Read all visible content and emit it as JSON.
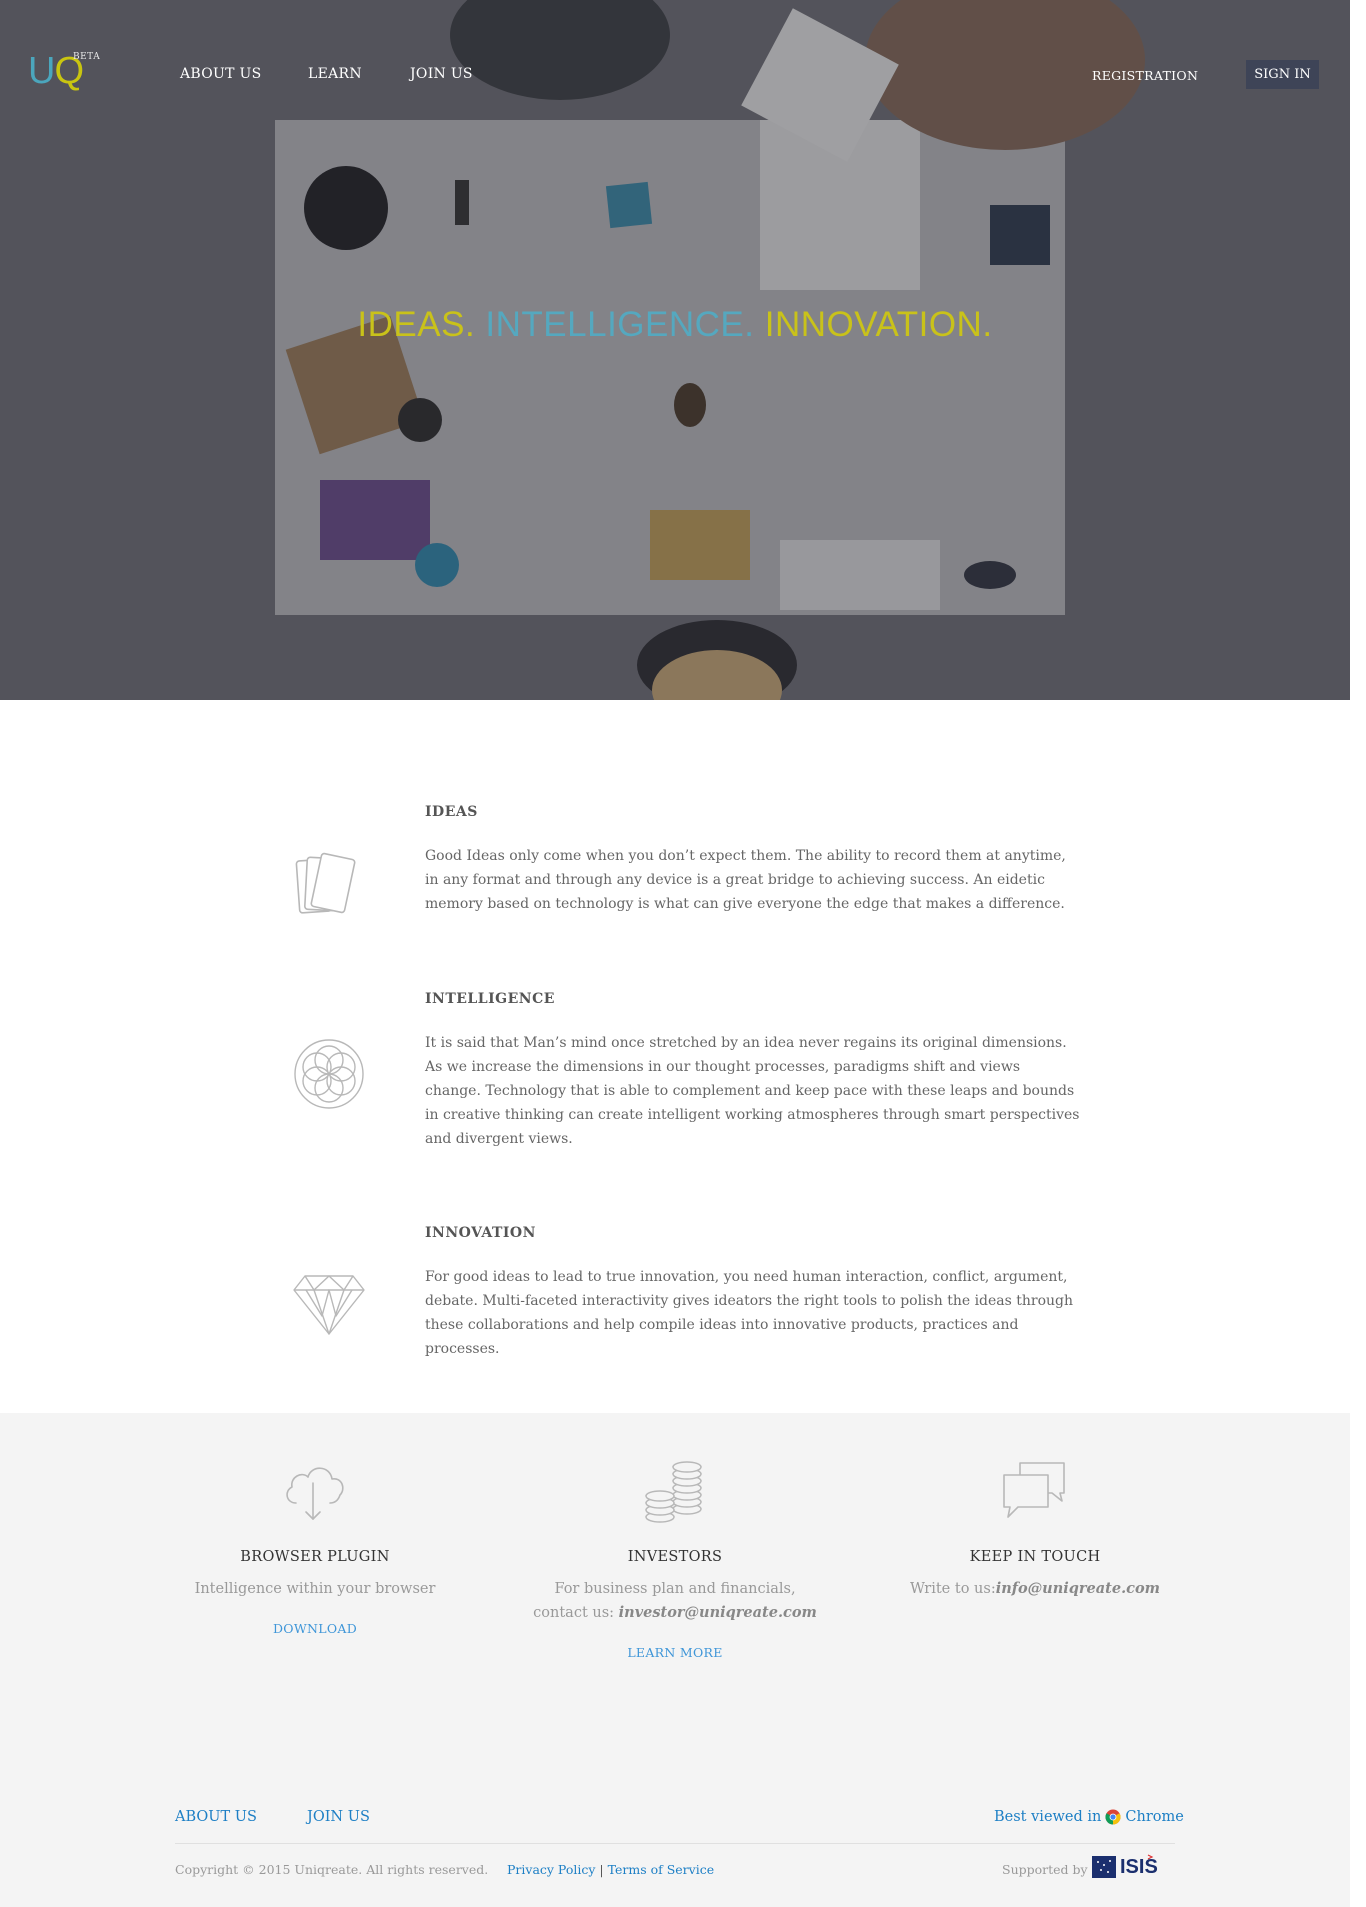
{
  "header": {
    "logo": {
      "u": "U",
      "q": "Q",
      "beta": "BETA"
    },
    "nav": [
      "ABOUT US",
      "LEARN",
      "JOIN US"
    ],
    "registration": "REGISTRATION",
    "sign_in": "SIGN IN"
  },
  "hero": {
    "tagline": {
      "part1": "IDEAS.",
      "part2": "INTELLIGENCE.",
      "part3": "INNOVATION."
    }
  },
  "features": [
    {
      "icon": "cards-icon",
      "title": "IDEAS",
      "text": "Good Ideas only come when you don’t expect them. The ability to record them at anytime, in any format and through any device is a great bridge to achieving success. An eidetic memory based on technology is what can give everyone the edge that makes a difference."
    },
    {
      "icon": "flower-of-life-icon",
      "title": "INTELLIGENCE",
      "text": "It is said that Man’s mind once stretched by an idea never regains its original dimensions. As we increase the dimensions in our thought processes, paradigms shift and views change. Technology that is able to complement and keep pace with these leaps and bounds in creative thinking can create intelligent working atmospheres through smart perspectives and divergent views."
    },
    {
      "icon": "diamond-icon",
      "title": "INNOVATION",
      "text": "For good ideas to lead to true innovation, you need human interaction, conflict, argument, debate. Multi-faceted interactivity gives ideators the right tools to polish the ideas through these collaborations and help compile ideas into innovative products, practices and processes."
    }
  ],
  "columns": {
    "plugin": {
      "icon": "cloud-download-icon",
      "title": "BROWSER PLUGIN",
      "desc": "Intelligence within your browser",
      "link": "DOWNLOAD"
    },
    "investors": {
      "icon": "coins-icon",
      "title": "INVESTORS",
      "desc_line1": "For business plan and financials,",
      "desc_line2_prefix": "contact us: ",
      "email": "investor@uniqreate.com",
      "link": "LEARN MORE"
    },
    "contact": {
      "icon": "chat-bubbles-icon",
      "title": "KEEP IN TOUCH",
      "desc_prefix": "Write to us:",
      "email": "info@uniqreate.com"
    }
  },
  "footer": {
    "links": [
      "ABOUT US",
      "JOIN US"
    ],
    "best_viewed_prefix": "Best viewed in",
    "browser": "Chrome",
    "copyright": "Copyright © 2015 Uniqreate. All rights reserved.",
    "privacy": "Privacy Policy",
    "separator": "|",
    "terms": "Terms of Service",
    "supported_by": "Supported by",
    "sponsor_logo": "ISIS"
  },
  "colors": {
    "logo_blue": "#4ba6bd",
    "logo_yellow": "#c9c510",
    "link_blue": "#1d7fc5",
    "signin_bg": "#3e4457",
    "band_bg": "#f4f4f4"
  }
}
